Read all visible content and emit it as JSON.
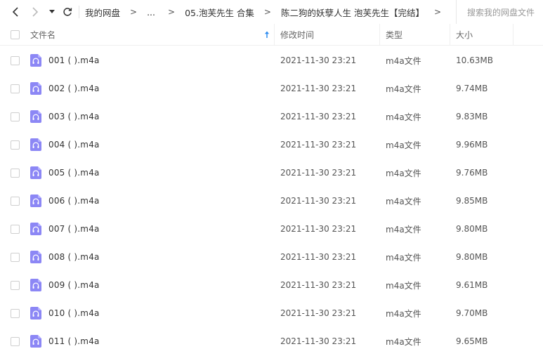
{
  "nav": {
    "breadcrumb": [
      "我的网盘",
      "...",
      "05.泡芙先生 合集",
      "陈二狗的妖孽人生  泡芙先生【完结】"
    ],
    "separator": ">",
    "search_placeholder": "搜索我的网盘文件"
  },
  "table": {
    "columns": {
      "name": "文件名",
      "modified": "修改时间",
      "type": "类型",
      "size": "大小"
    },
    "rows": [
      {
        "name": "001 (  ).m4a",
        "modified": "2021-11-30 23:21",
        "type": "m4a文件",
        "size": "10.63MB"
      },
      {
        "name": "002 (  ).m4a",
        "modified": "2021-11-30 23:21",
        "type": "m4a文件",
        "size": "9.74MB"
      },
      {
        "name": "003 (  ).m4a",
        "modified": "2021-11-30 23:21",
        "type": "m4a文件",
        "size": "9.83MB"
      },
      {
        "name": "004 (  ).m4a",
        "modified": "2021-11-30 23:21",
        "type": "m4a文件",
        "size": "9.96MB"
      },
      {
        "name": "005 (  ).m4a",
        "modified": "2021-11-30 23:21",
        "type": "m4a文件",
        "size": "9.76MB"
      },
      {
        "name": "006 (  ).m4a",
        "modified": "2021-11-30 23:21",
        "type": "m4a文件",
        "size": "9.85MB"
      },
      {
        "name": "007 (  ).m4a",
        "modified": "2021-11-30 23:21",
        "type": "m4a文件",
        "size": "9.80MB"
      },
      {
        "name": "008 (  ).m4a",
        "modified": "2021-11-30 23:21",
        "type": "m4a文件",
        "size": "9.80MB"
      },
      {
        "name": "009 (  ).m4a",
        "modified": "2021-11-30 23:21",
        "type": "m4a文件",
        "size": "9.61MB"
      },
      {
        "name": "010 (  ).m4a",
        "modified": "2021-11-30 23:21",
        "type": "m4a文件",
        "size": "9.70MB"
      },
      {
        "name": "011 (  ).m4a",
        "modified": "2021-11-30 23:21",
        "type": "m4a文件",
        "size": "9.65MB"
      }
    ]
  },
  "theme": {
    "accent": "#2e8cf0",
    "file_icon": "#8c87f5"
  },
  "icons": {
    "back": "chevron-left-icon",
    "forward": "chevron-right-icon",
    "dropdown": "caret-down-icon",
    "refresh": "refresh-icon",
    "sort": "arrow-up-icon",
    "file": "audio-file-icon"
  }
}
